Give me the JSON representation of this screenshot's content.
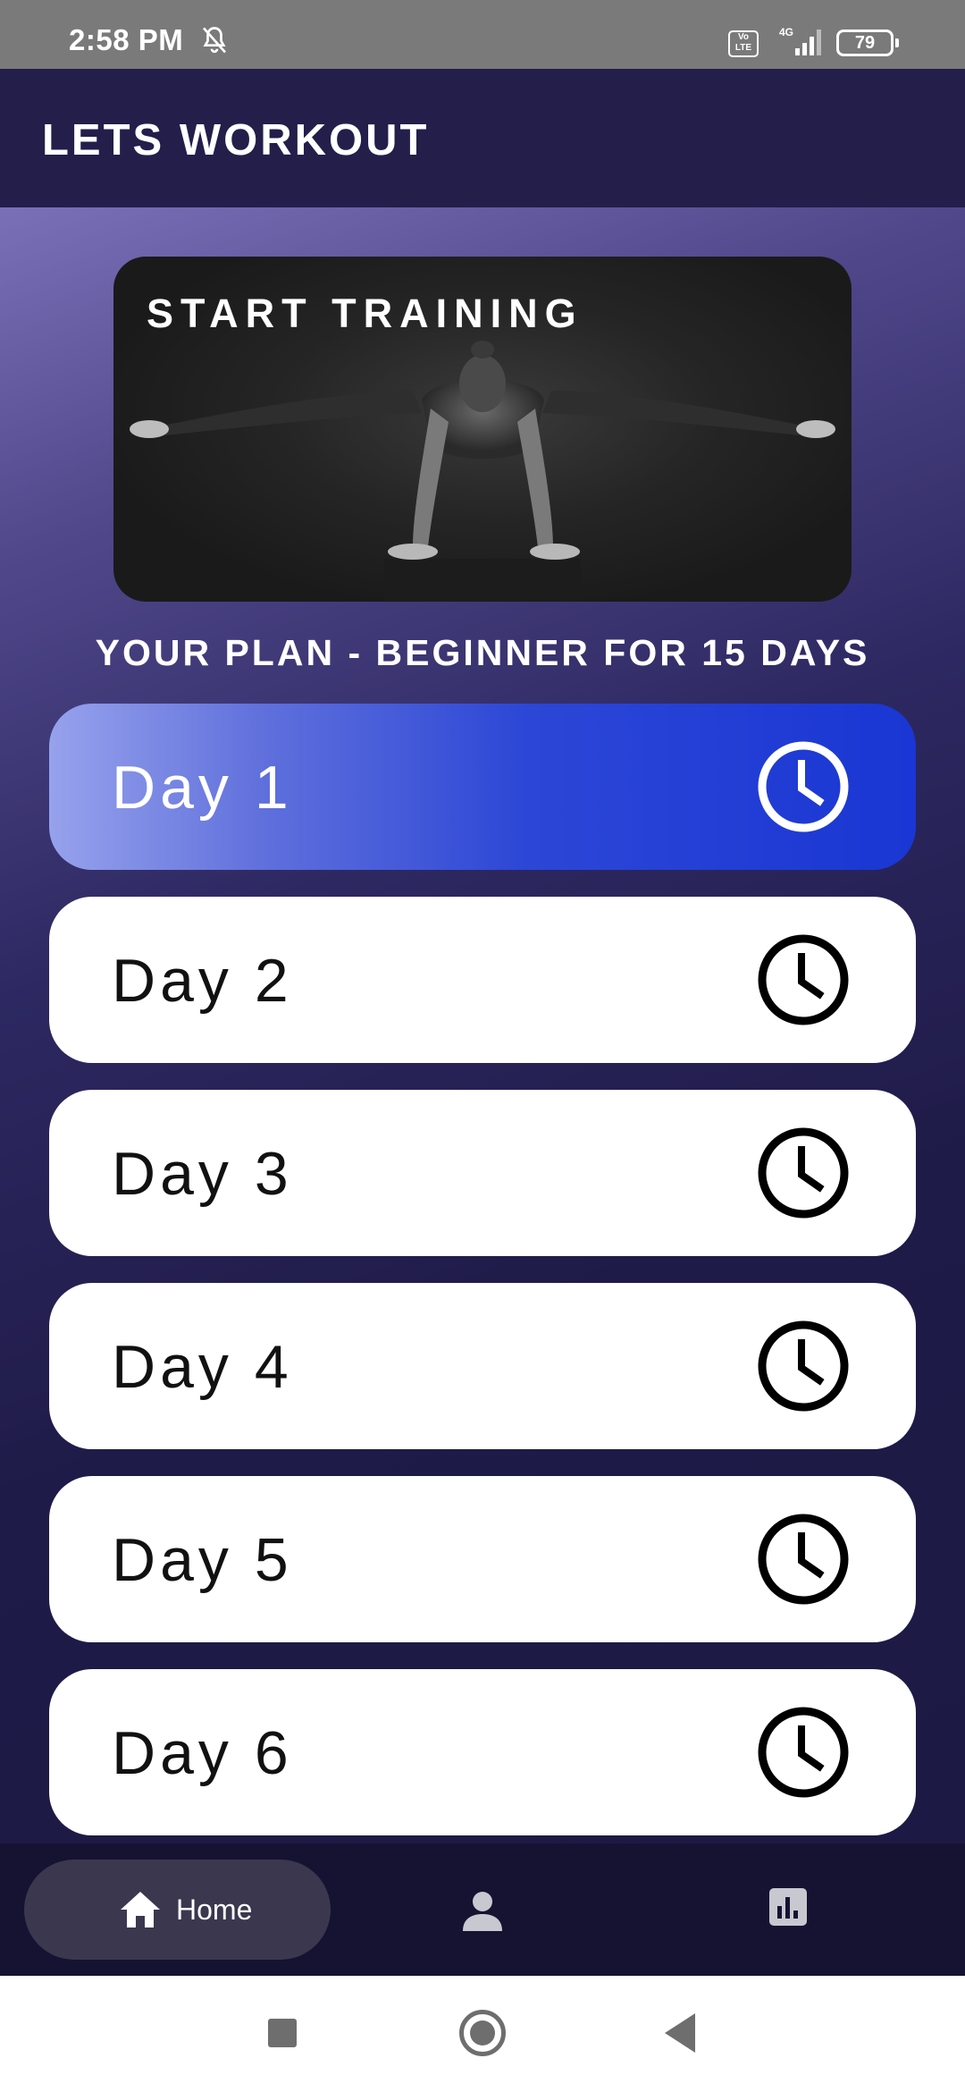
{
  "status_bar": {
    "time": "2:58 PM",
    "volte_label": "Vo LTE",
    "network_label": "4G",
    "battery": "79",
    "icons": [
      "bell-off-icon",
      "volte-icon",
      "signal-icon",
      "battery-icon"
    ]
  },
  "app_bar": {
    "title": "LETS WORKOUT"
  },
  "hero": {
    "title": "START TRAINING"
  },
  "plan": {
    "title": "YOUR PLAN - BEGINNER FOR 15 DAYS"
  },
  "days": [
    {
      "label": "Day 1",
      "active": true
    },
    {
      "label": "Day 2",
      "active": false
    },
    {
      "label": "Day 3",
      "active": false
    },
    {
      "label": "Day 4",
      "active": false
    },
    {
      "label": "Day 5",
      "active": false
    },
    {
      "label": "Day 6",
      "active": false
    }
  ],
  "bottom_nav": {
    "home_label": "Home",
    "icons": [
      "home-icon",
      "profile-icon",
      "stats-icon"
    ]
  },
  "colors": {
    "app_bar": "#231e4a",
    "active_day_start": "#97a2ec",
    "active_day_end": "#1a36d4",
    "bottom_nav": "#151331",
    "nav_selected": "#3a374f"
  }
}
